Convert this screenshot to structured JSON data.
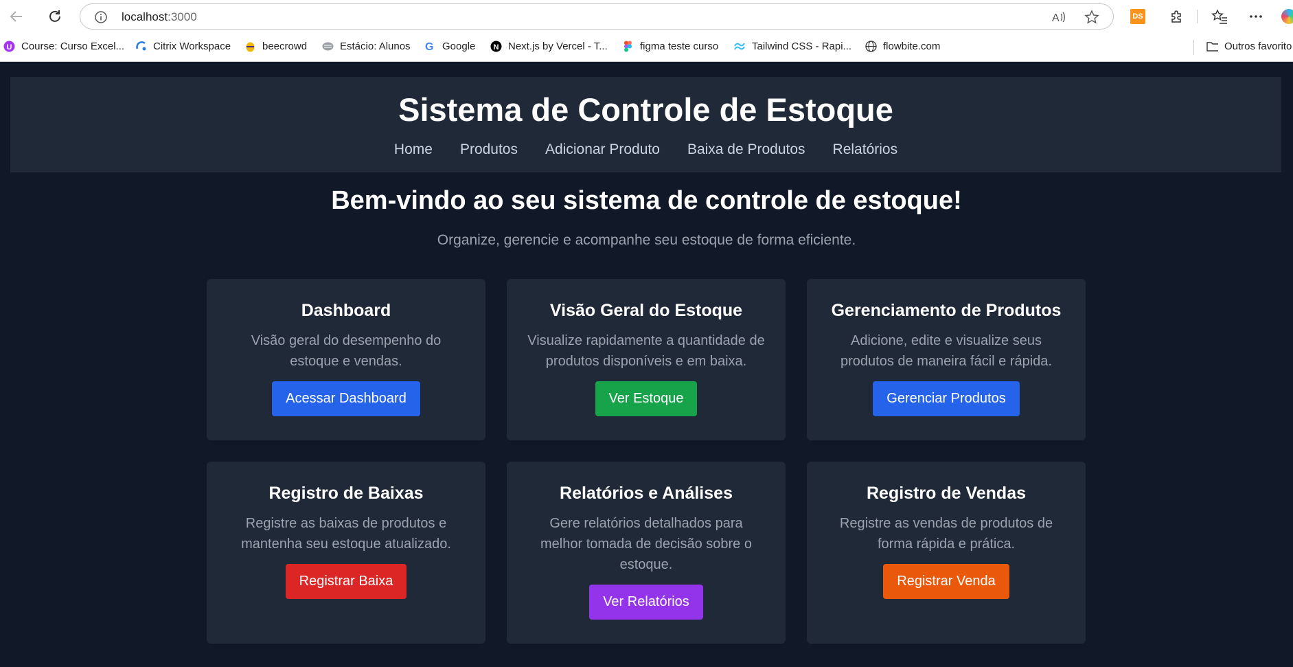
{
  "browser": {
    "url_host": "localhost",
    "url_port": ":3000",
    "ds_label": "DS",
    "bookmarks": [
      {
        "label": "Course: Curso Excel...",
        "icon": "udemy-icon",
        "color": "#a435f0"
      },
      {
        "label": "Citrix Workspace",
        "icon": "citrix-icon",
        "color": "#2a7de1"
      },
      {
        "label": "beecrowd",
        "icon": "beecrowd-icon",
        "color": "#f2b705"
      },
      {
        "label": "Estácio: Alunos",
        "icon": "estacio-icon",
        "color": "#888888"
      },
      {
        "label": "Google",
        "icon": "google-icon",
        "color": "#4285f4"
      },
      {
        "label": "Next.js by Vercel - T...",
        "icon": "nextjs-icon",
        "color": "#000000"
      },
      {
        "label": "figma teste curso",
        "icon": "figma-icon",
        "color": "#f24e1e"
      },
      {
        "label": "Tailwind CSS - Rapi...",
        "icon": "tailwind-icon",
        "color": "#38bdf8"
      },
      {
        "label": "flowbite.com",
        "icon": "globe-icon",
        "color": "#333333"
      }
    ],
    "other_favorites": "Outros favorito"
  },
  "app": {
    "title": "Sistema de Controle de Estoque",
    "nav": [
      "Home",
      "Produtos",
      "Adicionar Produto",
      "Baixa de Produtos",
      "Relatórios"
    ],
    "welcome": "Bem-vindo ao seu sistema de controle de estoque!",
    "subtitle": "Organize, gerencie e acompanhe seu estoque de forma eficiente.",
    "cards": [
      {
        "title": "Dashboard",
        "text": "Visão geral do desempenho do estoque e vendas.",
        "button": "Acessar Dashboard",
        "color": "#2563eb"
      },
      {
        "title": "Visão Geral do Estoque",
        "text": "Visualize rapidamente a quantidade de produtos disponíveis e em baixa.",
        "button": "Ver Estoque",
        "color": "#16a34a"
      },
      {
        "title": "Gerenciamento de Produtos",
        "text": "Adicione, edite e visualize seus produtos de maneira fácil e rápida.",
        "button": "Gerenciar Produtos",
        "color": "#2563eb"
      },
      {
        "title": "Registro de Baixas",
        "text": "Registre as baixas de produtos e mantenha seu estoque atualizado.",
        "button": "Registrar Baixa",
        "color": "#dc2626"
      },
      {
        "title": "Relatórios e Análises",
        "text": "Gere relatórios detalhados para melhor tomada de decisão sobre o estoque.",
        "button": "Ver Relatórios",
        "color": "#9333ea"
      },
      {
        "title": "Registro de Vendas",
        "text": "Registre as vendas de produtos de forma rápida e prática.",
        "button": "Registrar Venda",
        "color": "#ea580c"
      }
    ]
  }
}
